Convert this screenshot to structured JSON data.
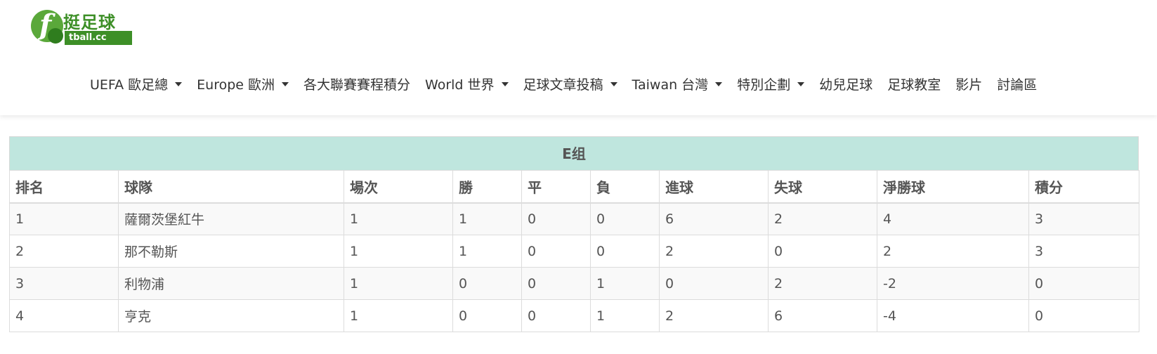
{
  "nav": {
    "items": [
      {
        "label": "UEFA 歐足總",
        "dropdown": true
      },
      {
        "label": "Europe 歐洲",
        "dropdown": true
      },
      {
        "label": "各大聯賽賽程積分",
        "dropdown": false
      },
      {
        "label": "World 世界",
        "dropdown": true
      },
      {
        "label": "足球文章投稿",
        "dropdown": true
      },
      {
        "label": "Taiwan 台灣",
        "dropdown": true
      },
      {
        "label": "特別企劃",
        "dropdown": true
      },
      {
        "label": "幼兒足球",
        "dropdown": false
      },
      {
        "label": "足球教室",
        "dropdown": false
      },
      {
        "label": "影片",
        "dropdown": false
      },
      {
        "label": "討論區",
        "dropdown": false
      }
    ]
  },
  "logo": {
    "cn": "挺足球",
    "en": "tball.cc"
  },
  "standings": {
    "group_title": "E组",
    "header_color": "#bfe6de",
    "columns": [
      "排名",
      "球隊",
      "場次",
      "勝",
      "平",
      "負",
      "進球",
      "失球",
      "淨勝球",
      "積分"
    ],
    "rows": [
      [
        "1",
        "薩爾茨堡紅牛",
        "1",
        "1",
        "0",
        "0",
        "6",
        "2",
        "4",
        "3"
      ],
      [
        "2",
        "那不勒斯",
        "1",
        "1",
        "0",
        "0",
        "2",
        "0",
        "2",
        "3"
      ],
      [
        "3",
        "利物浦",
        "1",
        "0",
        "0",
        "1",
        "0",
        "2",
        "-2",
        "0"
      ],
      [
        "4",
        "亨克",
        "1",
        "0",
        "0",
        "1",
        "2",
        "6",
        "-4",
        "0"
      ]
    ]
  }
}
